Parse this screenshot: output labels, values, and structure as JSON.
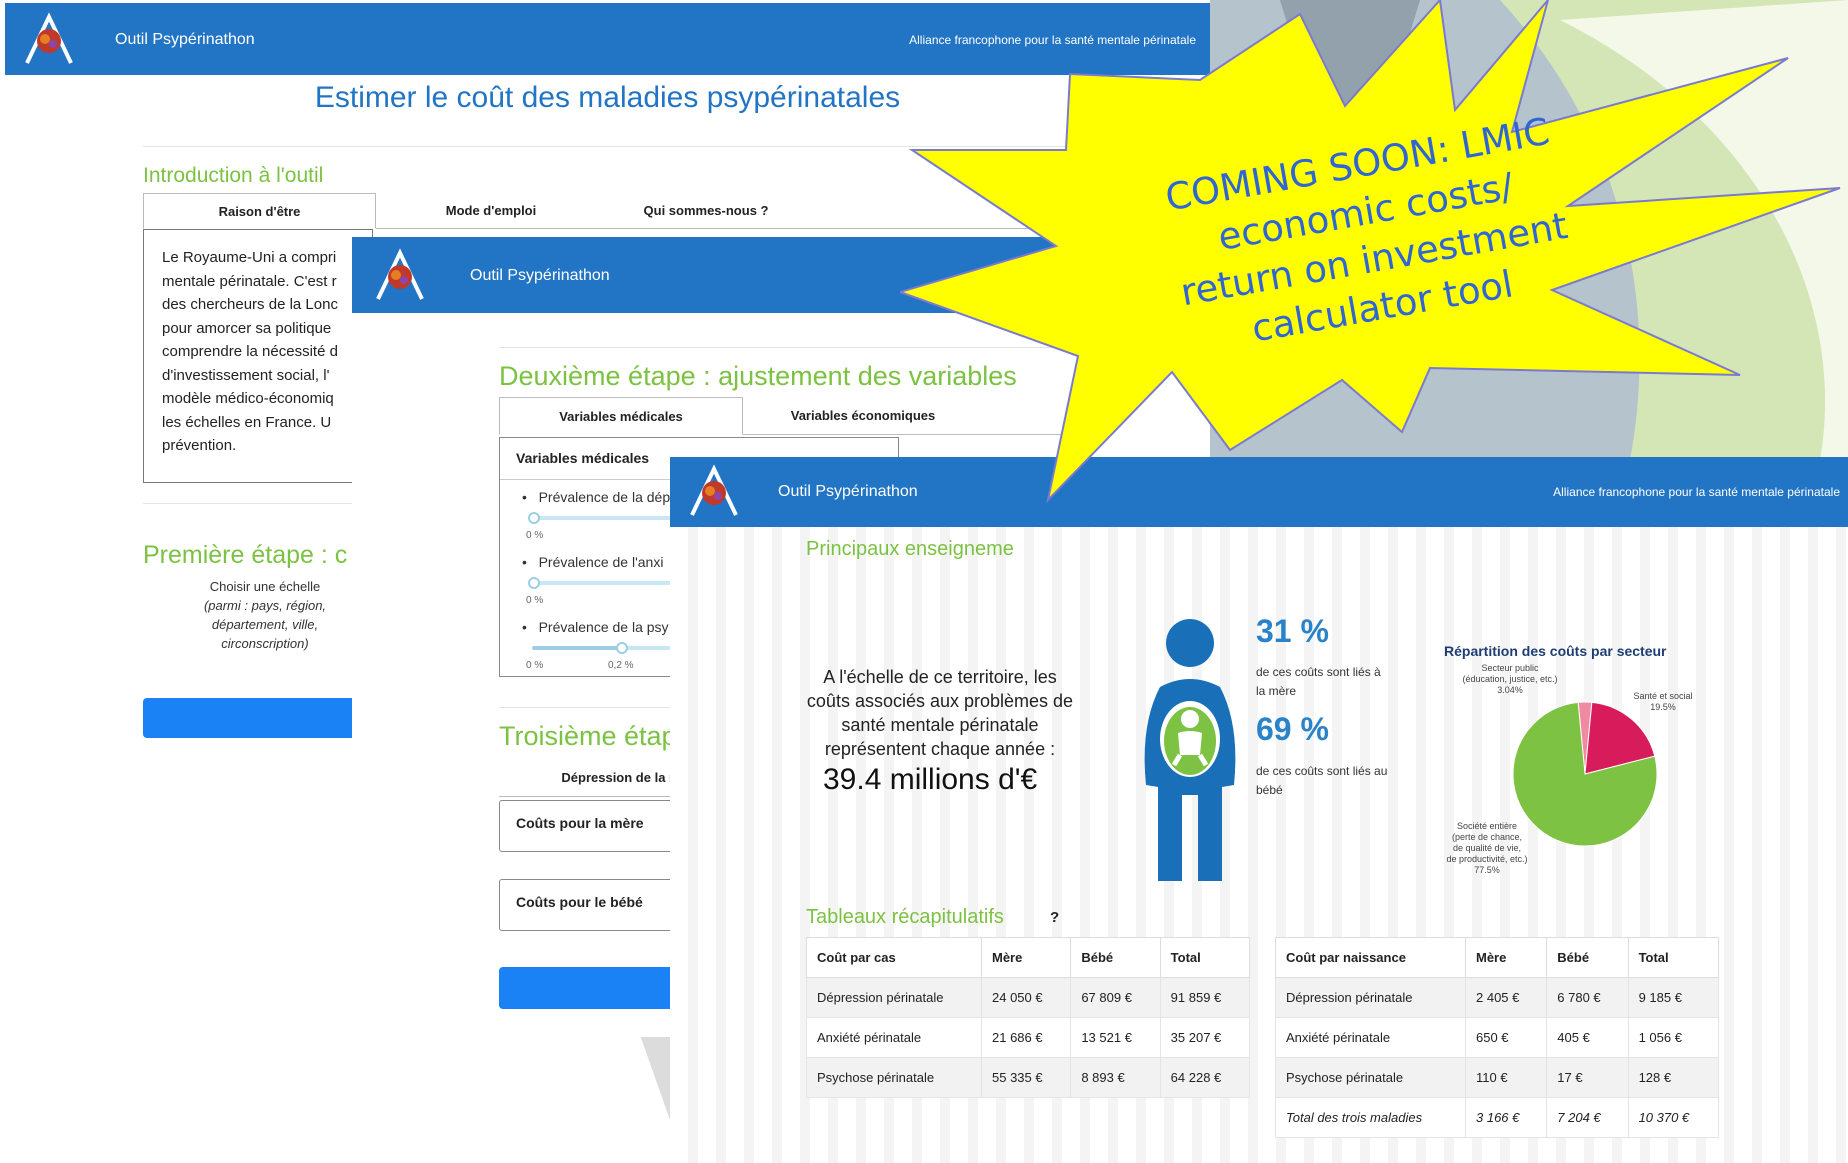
{
  "screen1": {
    "brand": "Outil Psypérinathon",
    "alliance": "Alliance francophone pour la santé mentale périnatale",
    "title": "Estimer le coût des maladies psypérinatales",
    "intro_heading": "Introduction à l'outil",
    "tabs": [
      "Raison d'être",
      "Mode d'emploi",
      "Qui sommes-nous ?"
    ],
    "intro_lines": [
      "Le Royaume-Uni a compri",
      "mentale périnatale. C'est r",
      "des chercheurs de la Lonc",
      "pour amorcer sa politique",
      "comprendre la nécessité d",
      "d'investissement social, l'",
      "modèle médico-économiq",
      "les échelles en France. U",
      "prévention."
    ],
    "step1_heading": "Première étape : c",
    "scale_choice": {
      "line1": "Choisir une échelle",
      "line2": "(parmi : pays, région,",
      "line3": "département, ville,",
      "line4": "circonscription)"
    }
  },
  "screen2": {
    "brand": "Outil Psypérinathon",
    "step2_heading": "Deuxième étape : ajustement des variables",
    "tabs": [
      "Variables médicales",
      "Variables économiques"
    ],
    "panel_title": "Variables médicales",
    "variables": [
      {
        "label": "Prévalence de la dép",
        "ticks": [
          "0 %"
        ],
        "value": 0
      },
      {
        "label": "Prévalence de l'anxi",
        "ticks": [
          "0 %"
        ],
        "value": 0
      },
      {
        "label": "Prévalence de la psy",
        "ticks": [
          "0 %",
          "0,2 %"
        ],
        "value": 0.2
      }
    ],
    "step3_heading": "Troisième étap",
    "step3_tab": "Dépression de la m",
    "cost_mother": "Coûts pour la mère",
    "cost_baby": "Coûts pour le bébé"
  },
  "screen3": {
    "brand": "Outil Psypérinathon",
    "alliance": "Alliance francophone pour la santé mentale périnatale",
    "findings_heading": "Principaux enseigneme",
    "para": [
      "A l'échelle de ce territoire, les",
      "coûts associés aux problèmes de",
      "santé mentale périnatale",
      "représentent chaque année :"
    ],
    "total_amount": "39.4 millions d'€",
    "mother_pct": "31 %",
    "mother_caption": [
      "de ces coûts sont liés à",
      "la mère"
    ],
    "baby_pct": "69 %",
    "baby_caption": [
      "de ces coûts sont liés au",
      "bébé"
    ],
    "recap_heading": "Tableaux récapitulatifs",
    "help_mark": "?",
    "table_case": {
      "headers": [
        "Coût par cas",
        "Mère",
        "Bébé",
        "Total"
      ],
      "rows": [
        [
          "Dépression périnatale",
          "24 050 €",
          "67 809 €",
          "91 859 €"
        ],
        [
          "Anxiété périnatale",
          "21 686 €",
          "13 521 €",
          "35 207 €"
        ],
        [
          "Psychose périnatale",
          "55 335 €",
          "8 893 €",
          "64 228 €"
        ]
      ]
    },
    "table_birth": {
      "headers": [
        "Coût par naissance",
        "Mère",
        "Bébé",
        "Total"
      ],
      "rows": [
        [
          "Dépression périnatale",
          "2 405 €",
          "6 780 €",
          "9 185 €"
        ],
        [
          "Anxiété périnatale",
          "650 €",
          "405 €",
          "1 056 €"
        ],
        [
          "Psychose périnatale",
          "110 €",
          "17 €",
          "128 €"
        ],
        [
          "Total des trois maladies",
          "3 166 €",
          "7 204 €",
          "10 370 €"
        ]
      ]
    }
  },
  "chart_data": {
    "type": "pie",
    "title": "Répartition des coûts par secteur",
    "slices": [
      {
        "name": "Secteur public (éducation, justice, etc.)",
        "value": 3.04,
        "label": "3.04%",
        "color": "#f08aa0"
      },
      {
        "name": "Santé et social",
        "value": 19.5,
        "label": "19.5%",
        "color": "#d81b5a"
      },
      {
        "name": "Société entière (perte de chance, de qualité de vie, de productivité, etc.)",
        "value": 77.5,
        "label": "77.5%",
        "color": "#7dc243"
      }
    ],
    "labels": {
      "public": [
        "Secteur public",
        "(éducation, justice, etc.)",
        "3.04%"
      ],
      "health": [
        "Santé et social",
        "19.5%"
      ],
      "society": [
        "Société entière",
        "(perte de chance,",
        "de qualité de vie,",
        "de productivité, etc.)",
        "77.5%"
      ]
    }
  },
  "starburst": {
    "lines": [
      "COMING SOON: LMIC",
      "economic costs/",
      "return on investment",
      "calculator tool"
    ],
    "fill": "#ffff00",
    "text_color": "#2f66d4"
  },
  "colors": {
    "navbar": "#2274c4",
    "heading_green": "#7cc242",
    "title_blue": "#2274c4",
    "button_blue": "#1a82f5"
  }
}
